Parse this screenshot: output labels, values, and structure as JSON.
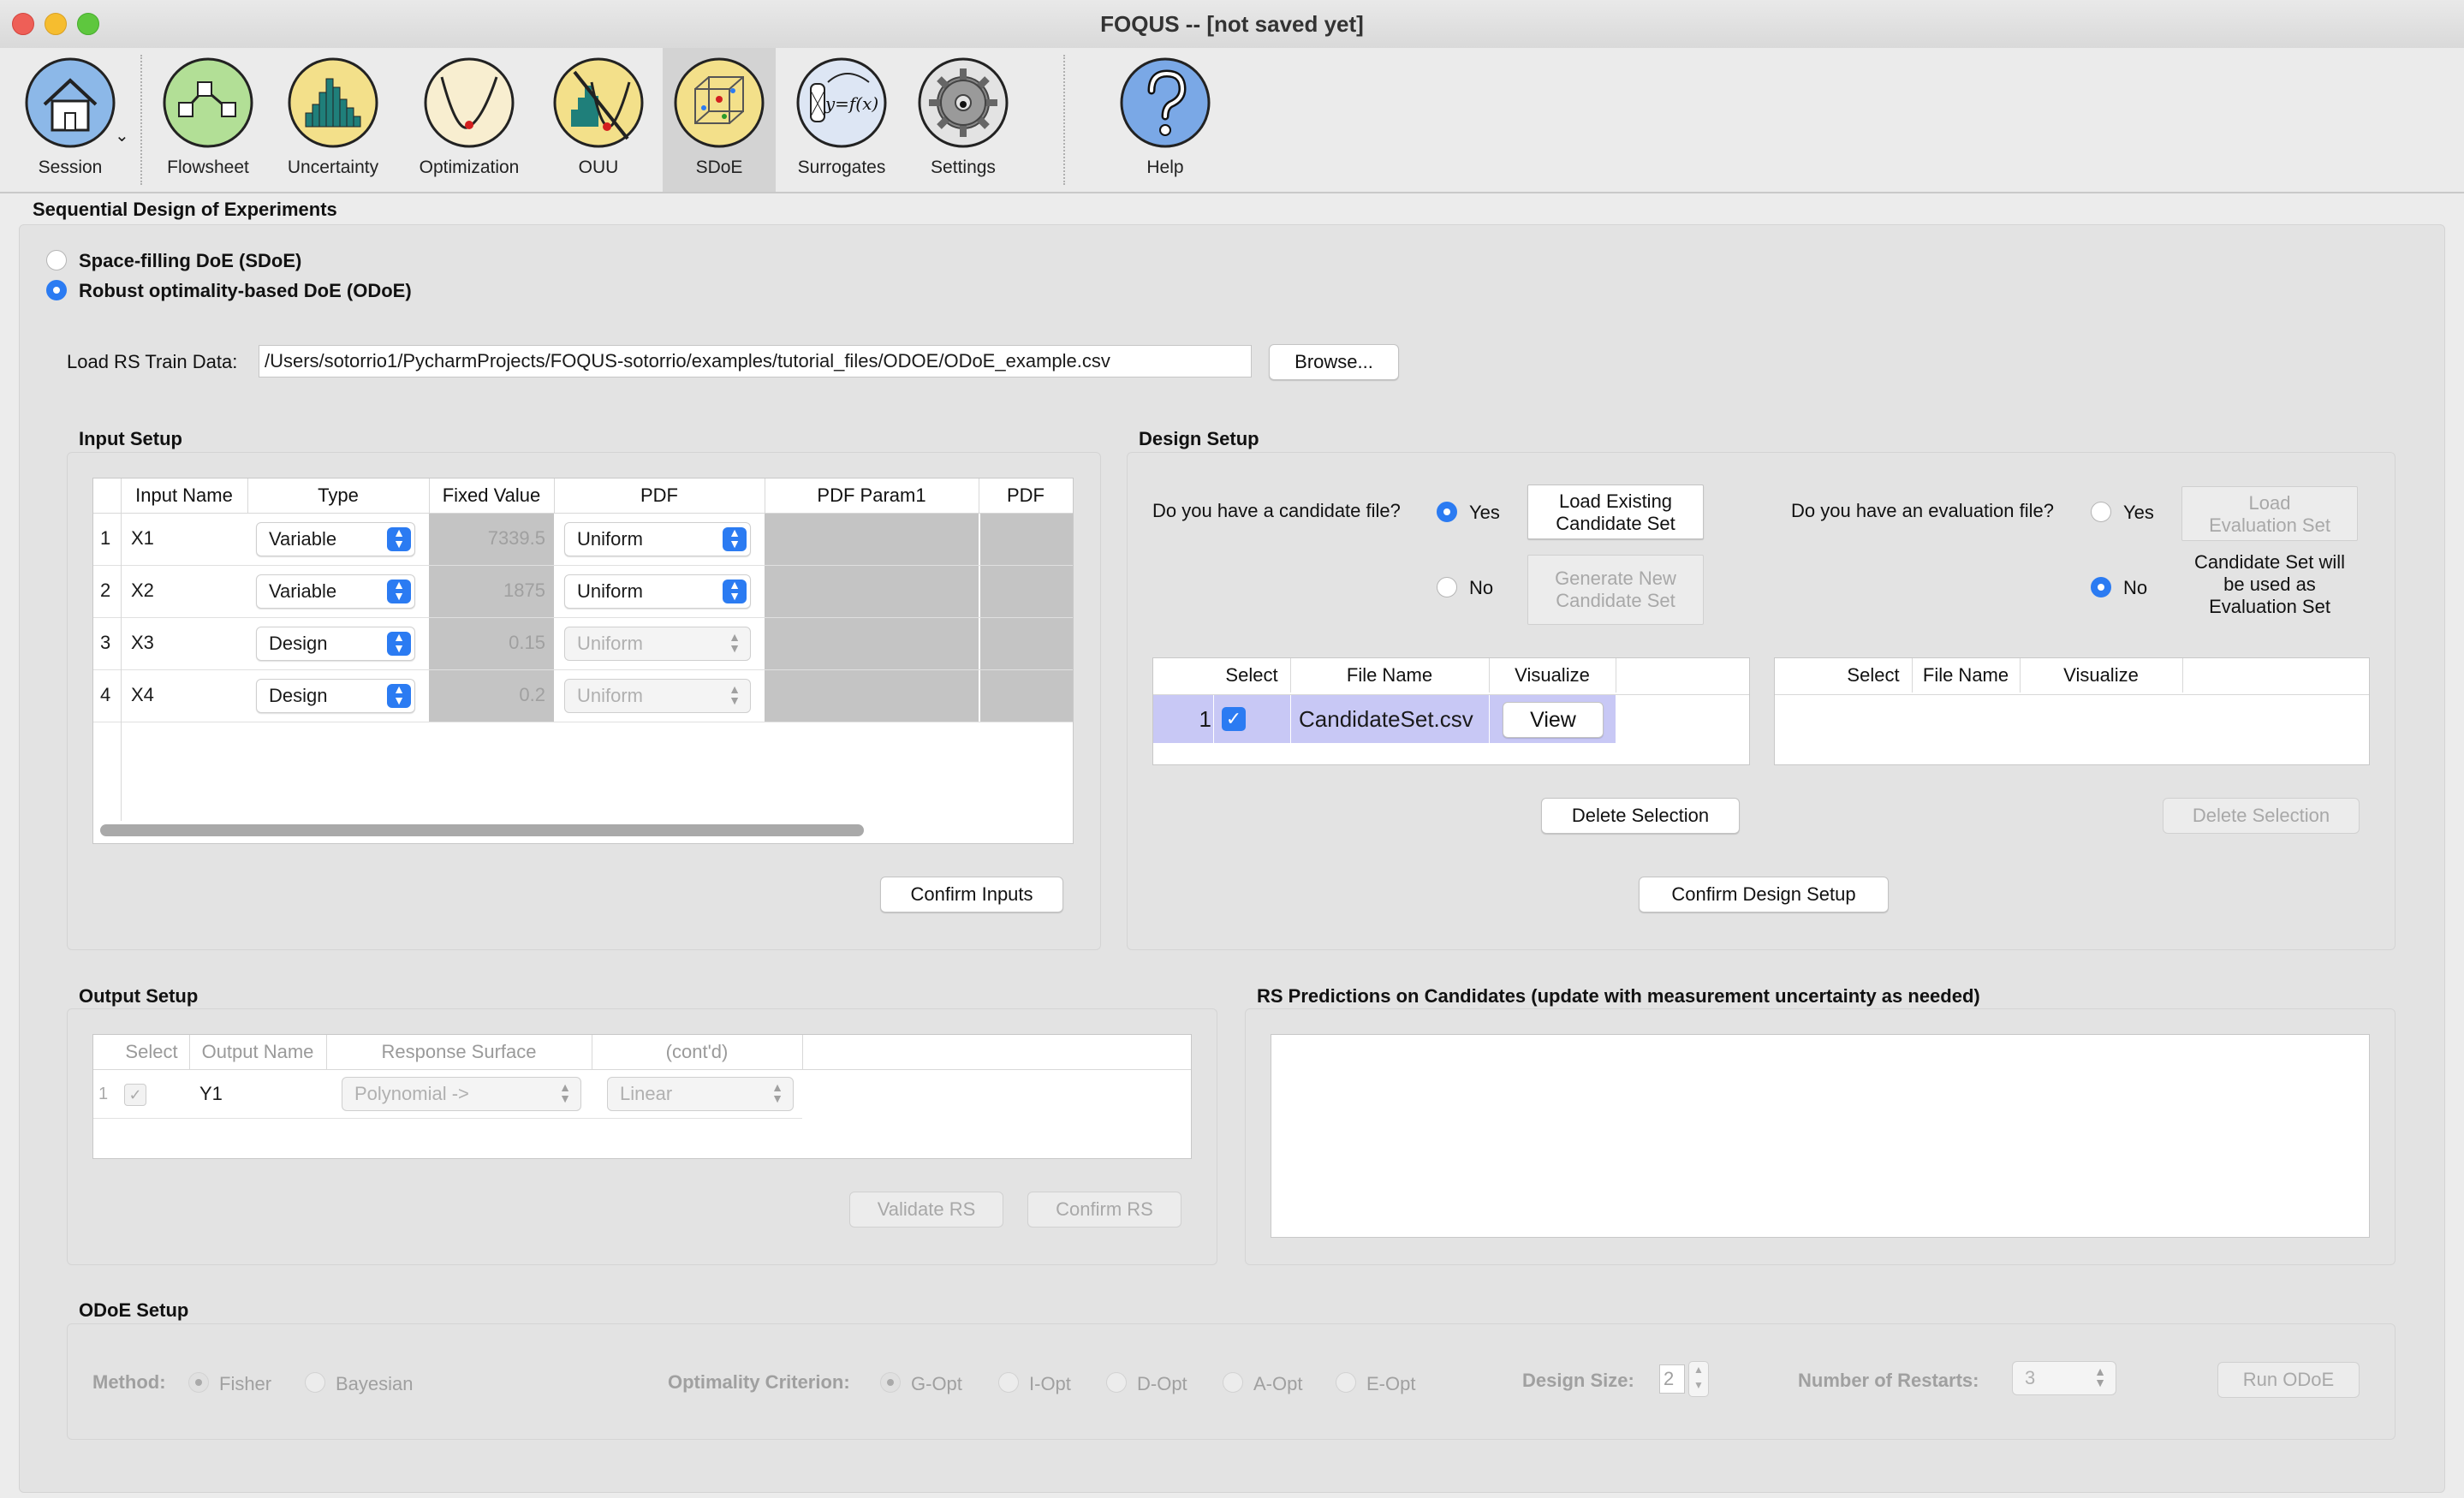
{
  "window": {
    "title": "FOQUS -- [not saved yet]"
  },
  "toolbar": {
    "items": [
      {
        "label": "Session",
        "icon": "house-icon"
      },
      {
        "label": "Flowsheet",
        "icon": "flowsheet-icon"
      },
      {
        "label": "Uncertainty",
        "icon": "histogram-icon"
      },
      {
        "label": "Optimization",
        "icon": "optimization-curve-icon"
      },
      {
        "label": "OUU",
        "icon": "ouu-icon"
      },
      {
        "label": "SDoE",
        "icon": "sdoe-cube-icon",
        "active": true
      },
      {
        "label": "Surrogates",
        "icon": "surrogate-function-icon"
      },
      {
        "label": "Settings",
        "icon": "gear-icon"
      },
      {
        "label": "Help",
        "icon": "question-icon"
      }
    ],
    "surrogate_glyph": "y=f(x)"
  },
  "page": {
    "heading": "Sequential Design of Experiments",
    "radio_sdoe": "Space-filling DoE (SDoE)",
    "radio_odoe": "Robust optimality-based DoE (ODoE)",
    "load_label": "Load RS Train Data:",
    "load_path": "/Users/sotorrio1/PycharmProjects/FOQUS-sotorrio/examples/tutorial_files/ODOE/ODoE_example.csv",
    "browse": "Browse..."
  },
  "input_setup": {
    "title": "Input Setup",
    "columns": [
      "Input Name",
      "Type",
      "Fixed Value",
      "PDF",
      "PDF Param1",
      "PDF"
    ],
    "rows": [
      {
        "n": "1",
        "name": "X1",
        "type": "Variable",
        "fixed": "7339.5",
        "pdf": "Uniform"
      },
      {
        "n": "2",
        "name": "X2",
        "type": "Variable",
        "fixed": "1875",
        "pdf": "Uniform"
      },
      {
        "n": "3",
        "name": "X3",
        "type": "Design",
        "fixed": "0.15",
        "pdf": "Uniform"
      },
      {
        "n": "4",
        "name": "X4",
        "type": "Design",
        "fixed": "0.2",
        "pdf": "Uniform"
      }
    ],
    "confirm": "Confirm Inputs"
  },
  "design_setup": {
    "title": "Design Setup",
    "candidate_q": "Do you have a candidate file?",
    "yes": "Yes",
    "no": "No",
    "load_existing": [
      "Load Existing",
      "Candidate Set"
    ],
    "generate_new": [
      "Generate New",
      "Candidate Set"
    ],
    "eval_q": "Do you have an evaluation file?",
    "load_eval": [
      "Load",
      "Evaluation Set"
    ],
    "eval_note": [
      "Candidate Set will",
      "be used as",
      "Evaluation Set"
    ],
    "cand_columns": [
      "Select",
      "File Name",
      "Visualize"
    ],
    "cand_rows": [
      {
        "n": "1",
        "file": "CandidateSet.csv",
        "view": "View"
      }
    ],
    "eval_columns": [
      "Select",
      "File Name",
      "Visualize"
    ],
    "delete": "Delete Selection",
    "delete_eval": "Delete Selection",
    "confirm": "Confirm Design Setup"
  },
  "output_setup": {
    "title": "Output Setup",
    "columns": [
      "Select",
      "Output Name",
      "Response Surface",
      "(cont'd)"
    ],
    "rows": [
      {
        "n": "1",
        "name": "Y1",
        "rs": "Polynomial ->",
        "rs2": "Linear"
      }
    ],
    "validate": "Validate RS",
    "confirm": "Confirm RS"
  },
  "rs_predictions": {
    "title": "RS Predictions on Candidates (update with measurement uncertainty as needed)"
  },
  "odoe_setup": {
    "title": "ODoE Setup",
    "method_label": "Method:",
    "methods": [
      "Fisher",
      "Bayesian"
    ],
    "criterion_label": "Optimality Criterion:",
    "criteria": [
      "G-Opt",
      "I-Opt",
      "D-Opt",
      "A-Opt",
      "E-Opt"
    ],
    "design_size_label": "Design Size:",
    "design_size": "2",
    "restarts_label": "Number of Restarts:",
    "restarts": "3",
    "run": "Run ODoE"
  },
  "colors": {
    "accent": "#2b7bf2",
    "selection_row": "#c8c8f5"
  }
}
